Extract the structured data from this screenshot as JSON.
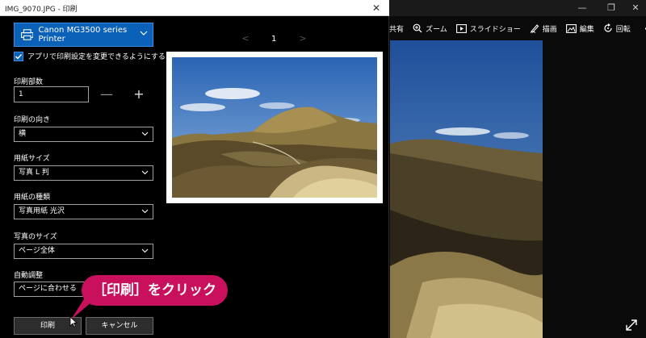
{
  "dialog": {
    "title": "IMG_9070.JPG - 印刷",
    "printer": {
      "name": "Canon MG3500 series Printer"
    },
    "checkbox_label": "アプリで印刷設定を変更できるようにする",
    "copies": {
      "label": "印刷部数",
      "value": "1"
    },
    "orientation": {
      "label": "印刷の向き",
      "value": "横"
    },
    "paper_size": {
      "label": "用紙サイズ",
      "value": "写真 L 判"
    },
    "paper_type": {
      "label": "用紙の種類",
      "value": "写真用紙 光沢"
    },
    "photo_size": {
      "label": "写真のサイズ",
      "value": "ページ全体"
    },
    "auto_adjust": {
      "label": "自動調整",
      "value": "ページに合わせる"
    },
    "print_label": "印刷",
    "cancel_label": "キャンセル",
    "page_number": "1"
  },
  "callout": {
    "text": "［印刷］をクリック"
  },
  "photos_toolbar": {
    "share": "共有",
    "zoom": "ズーム",
    "slideshow": "スライドショー",
    "draw": "描画",
    "edit": "編集",
    "rotate": "回転",
    "more": "···"
  },
  "icons": [
    "printer-icon",
    "chevron-down-icon",
    "checkmark-icon",
    "zoom-icon",
    "slideshow-icon",
    "pen-icon",
    "edit-icon",
    "rotate-icon",
    "expand-icon",
    "close-icon",
    "cursor-icon"
  ],
  "colors": {
    "accent": "#0b61b8",
    "callout": "#c8105c",
    "background": "#000000"
  }
}
